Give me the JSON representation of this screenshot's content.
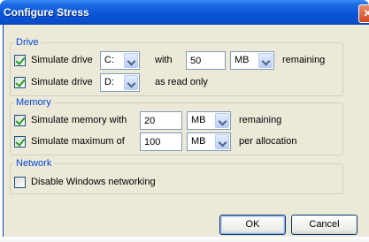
{
  "window": {
    "title": "Configure Stress",
    "close_glyph": "✕"
  },
  "drive": {
    "legend": "Drive",
    "row1": {
      "checked": true,
      "label": "Simulate drive",
      "drive": "C:",
      "with_label": "with",
      "amount": "50",
      "unit": "MB",
      "suffix": "remaining"
    },
    "row2": {
      "checked": true,
      "label": "Simulate drive",
      "drive": "D:",
      "suffix": "as read only"
    }
  },
  "memory": {
    "legend": "Memory",
    "row1": {
      "checked": true,
      "label": "Simulate memory with",
      "amount": "20",
      "unit": "MB",
      "suffix": "remaining"
    },
    "row2": {
      "checked": true,
      "label": "Simulate maximum of",
      "amount": "100",
      "unit": "MB",
      "suffix": "per allocation"
    }
  },
  "network": {
    "legend": "Network",
    "row1": {
      "checked": false,
      "label": "Disable Windows networking"
    }
  },
  "buttons": {
    "ok": "OK",
    "cancel": "Cancel"
  }
}
